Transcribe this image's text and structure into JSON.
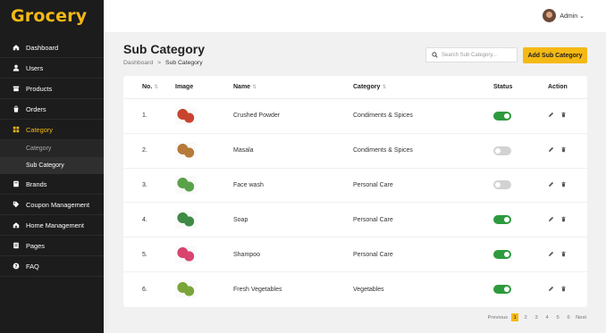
{
  "app": {
    "logo": "Grocery"
  },
  "user": {
    "name": "Admin ⌄"
  },
  "sidebar": {
    "items": [
      {
        "label": "Dashboard",
        "icon": "home-icon"
      },
      {
        "label": "Users",
        "icon": "user-icon"
      },
      {
        "label": "Products",
        "icon": "box-icon"
      },
      {
        "label": "Orders",
        "icon": "bag-icon"
      },
      {
        "label": "Category",
        "icon": "grid-icon",
        "active": true
      },
      {
        "label": "Brands",
        "icon": "bookmark-icon"
      },
      {
        "label": "Coupon Management",
        "icon": "tag-icon"
      },
      {
        "label": "Home Management",
        "icon": "house-icon"
      },
      {
        "label": "Pages",
        "icon": "page-icon"
      },
      {
        "label": "FAQ",
        "icon": "question-icon"
      }
    ],
    "sub": [
      {
        "label": "Category"
      },
      {
        "label": "Sub Category",
        "active": true
      }
    ]
  },
  "header": {
    "title": "Sub Category",
    "breadcrumb_home": "Dashboard",
    "breadcrumb_sep": ">",
    "breadcrumb_current": "Sub Category",
    "search_placeholder": "Search Sub Category...",
    "add_label": "Add Sub Category"
  },
  "table": {
    "columns": {
      "no": "No.",
      "image": "Image",
      "name": "Name",
      "category": "Category",
      "status": "Status",
      "action": "Action"
    },
    "sort_glyph": "⇅",
    "rows": [
      {
        "no": "1.",
        "name": "Crushed Powder",
        "category": "Condiments & Spices",
        "status": true,
        "thumb": "#c8442e"
      },
      {
        "no": "2.",
        "name": "Masala",
        "category": "Condiments & Spices",
        "status": false,
        "thumb": "#b87a3a"
      },
      {
        "no": "3.",
        "name": "Face wash",
        "category": "Personal Care",
        "status": false,
        "thumb": "#5aa24a"
      },
      {
        "no": "4.",
        "name": "Soap",
        "category": "Personal Care",
        "status": true,
        "thumb": "#3f8a45"
      },
      {
        "no": "5.",
        "name": "Shampoo",
        "category": "Personal Care",
        "status": true,
        "thumb": "#d9446e"
      },
      {
        "no": "6.",
        "name": "Fresh Vegetables",
        "category": "Vegetables",
        "status": true,
        "thumb": "#7aa53a"
      }
    ]
  },
  "pagination": {
    "previous": "Previous",
    "pages": [
      "1",
      "2",
      "3",
      "4",
      "5",
      "6"
    ],
    "current": "1",
    "next": "Next"
  },
  "colors": {
    "accent": "#f5b915",
    "sidebar": "#1c1c1c",
    "toggle_on": "#2e9a3e",
    "toggle_off": "#d2d2d2"
  }
}
